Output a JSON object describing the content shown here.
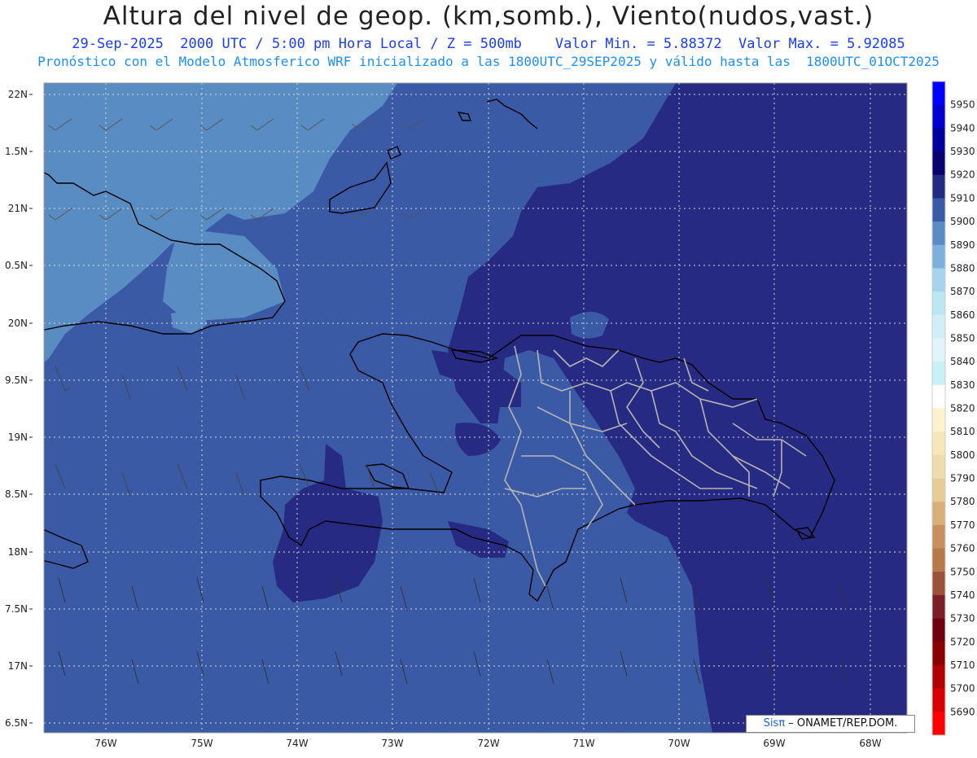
{
  "header": {
    "title": "Altura del nivel de geop. (km,somb.), Viento(nudos,vast.)",
    "subtitle_date": "29-Sep-2025  2000 UTC / 5:00 pm Hora Local / Z = 500mb",
    "subtitle_values": "Valor Min. = 5.88372  Valor Max. = 5.92085",
    "forecast_line": "Pronóstico con el Modelo Atmosferico WRF inicializado a las 1800UTC_29SEP2025 y válido hasta las  1800UTC_01OCT2025"
  },
  "map": {
    "lat_labels": [
      "22N",
      "1.5N",
      "21N",
      "0.5N",
      "20N",
      "9.5N",
      "19N",
      "8.5N",
      "18N",
      "7.5N",
      "17N",
      "6.5N"
    ],
    "lon_labels": [
      "76W",
      "75W",
      "74W",
      "73W",
      "72W",
      "71W",
      "70W",
      "69W",
      "68W"
    ],
    "colors": {
      "shade_5890": "#5a8cc4",
      "shade_5900": "#3b5aa6",
      "shade_5910": "#262a82",
      "coast": "#000000",
      "borders": "#b4b4b4",
      "grid": "#d8d8d8"
    }
  },
  "colorbar": {
    "levels": [
      "5950",
      "5940",
      "5930",
      "5920",
      "5910",
      "5900",
      "5890",
      "5880",
      "5870",
      "5860",
      "5850",
      "5840",
      "5830",
      "5820",
      "5810",
      "5800",
      "5790",
      "5780",
      "5770",
      "5760",
      "5750",
      "5740",
      "5730",
      "5720",
      "5710",
      "5700",
      "5690"
    ],
    "colors": [
      "#0000ff",
      "#0000d0",
      "#00009c",
      "#0a0070",
      "#232a82",
      "#3b5aa6",
      "#5a8cc4",
      "#7db0da",
      "#a6d4ec",
      "#bde6f2",
      "#d0eef6",
      "#e0f4fa",
      "#c9f0f6",
      "#ffffff",
      "#fbf3cf",
      "#f6e6b8",
      "#efdcac",
      "#e7cc98",
      "#d9b078",
      "#c8905a",
      "#b47a4a",
      "#9c5238",
      "#7c1f28",
      "#700010",
      "#8a0000",
      "#b00000",
      "#d80000",
      "#ff0000"
    ]
  },
  "credit": {
    "brand": "Sisπ",
    "text": " – ONAMET/REP.DOM."
  }
}
